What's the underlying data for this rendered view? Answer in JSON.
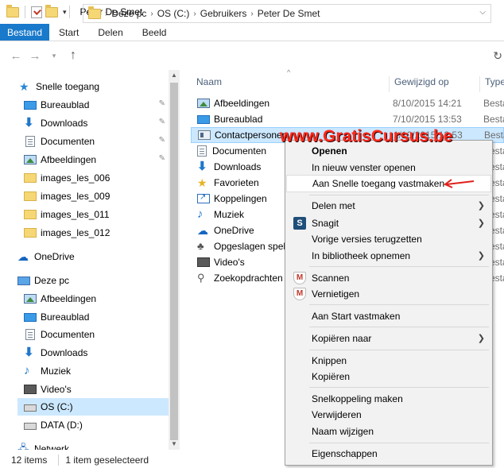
{
  "window": {
    "title": "Peter De Smet"
  },
  "ribbon": {
    "tabs": [
      "Bestand",
      "Start",
      "Delen",
      "Beeld"
    ]
  },
  "address": {
    "segments": [
      "Deze pc",
      "OS (C:)",
      "Gebruikers",
      "Peter De Smet"
    ]
  },
  "navigation": {
    "quick_access": "Snelle toegang",
    "quick_items": [
      "Bureaublad",
      "Downloads",
      "Documenten",
      "Afbeeldingen",
      "images_les_006",
      "images_les_009",
      "images_les_011",
      "images_les_012"
    ],
    "onedrive": "OneDrive",
    "this_pc": "Deze pc",
    "pc_items": [
      "Afbeeldingen",
      "Bureaublad",
      "Documenten",
      "Downloads",
      "Muziek",
      "Video's",
      "OS (C:)",
      "DATA (D:)"
    ],
    "network": "Netwerk"
  },
  "columns": {
    "name": "Naam",
    "modified": "Gewijzigd op",
    "type": "Type"
  },
  "files": [
    {
      "name": "Afbeeldingen",
      "date": "8/10/2015 14:21",
      "type": "Besta"
    },
    {
      "name": "Bureaublad",
      "date": "7/10/2015 13:53",
      "type": "Besta"
    },
    {
      "name": "Contactpersonen",
      "date": "1/10/2015 12:53",
      "type": "Besta"
    },
    {
      "name": "Documenten",
      "date": "",
      "type": "Besta"
    },
    {
      "name": "Downloads",
      "date": "",
      "type": "Besta"
    },
    {
      "name": "Favorieten",
      "date": "",
      "type": "Besta"
    },
    {
      "name": "Koppelingen",
      "date": "",
      "type": "Besta"
    },
    {
      "name": "Muziek",
      "date": "",
      "type": "Besta"
    },
    {
      "name": "OneDrive",
      "date": "",
      "type": "Besta"
    },
    {
      "name": "Opgeslagen spelle",
      "date": "",
      "type": "Besta"
    },
    {
      "name": "Video's",
      "date": "",
      "type": "Besta"
    },
    {
      "name": "Zoekopdrachten",
      "date": "",
      "type": "Besta"
    }
  ],
  "watermark": "www.GratisCursus.be",
  "context_menu": {
    "open": "Openen",
    "open_new_window": "In nieuw venster openen",
    "pin_quick_access": "Aan Snelle toegang vastmaken",
    "share_with": "Delen met",
    "snagit": "Snagit",
    "restore_versions": "Vorige versies terugzetten",
    "include_library": "In bibliotheek opnemen",
    "scan": "Scannen",
    "shred": "Vernietigen",
    "pin_start": "Aan Start vastmaken",
    "copy_to": "Kopiëren naar",
    "cut": "Knippen",
    "copy": "Kopiëren",
    "create_shortcut": "Snelkoppeling maken",
    "delete": "Verwijderen",
    "rename": "Naam wijzigen",
    "properties": "Eigenschappen"
  },
  "status": {
    "items": "12 items",
    "selected": "1 item geselecteerd"
  },
  "colors": {
    "accent": "#1979ca",
    "selection": "#cce8ff",
    "watermark": "#ff2a1a",
    "arrow": "#e0201a"
  }
}
